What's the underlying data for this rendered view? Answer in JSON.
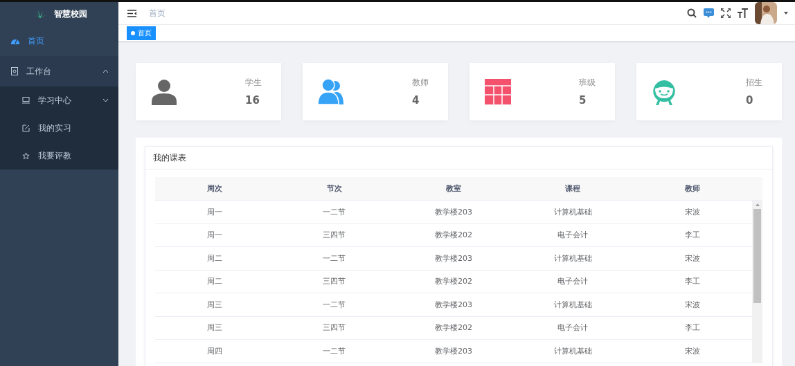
{
  "sidebar": {
    "logo": "智慧校园",
    "items": [
      {
        "label": "首页",
        "kind": "home",
        "selected": true
      },
      {
        "label": "工作台",
        "kind": "workbench",
        "selected": false,
        "expanded": true,
        "children": [
          {
            "label": "学习中心",
            "kind": "study",
            "selected": false,
            "expanded": false
          },
          {
            "label": "我的实习",
            "kind": "edit",
            "selected": false
          },
          {
            "label": "我要评教",
            "kind": "star",
            "selected": false
          }
        ]
      }
    ]
  },
  "header": {
    "breadcrumb": "首页"
  },
  "tags": [
    {
      "label": "首页",
      "selected": true
    }
  ],
  "stats": [
    {
      "label": "学生",
      "value": "16",
      "kind": "person",
      "color": "#666666"
    },
    {
      "label": "教师",
      "value": "4",
      "kind": "people",
      "color": "#36a3f7"
    },
    {
      "label": "班级",
      "value": "5",
      "kind": "table",
      "color": "#f4516c"
    },
    {
      "label": "招生",
      "value": "0",
      "kind": "smile",
      "color": "#34bfa3"
    }
  ],
  "schedule": {
    "title": "我的课表",
    "columns": [
      "周次",
      "节次",
      "教室",
      "课程",
      "教师"
    ],
    "rows": [
      [
        "周一",
        "一二节",
        "教学楼203",
        "计算机基础",
        "宋波"
      ],
      [
        "周一",
        "三四节",
        "教学楼202",
        "电子会计",
        "李工"
      ],
      [
        "周二",
        "一二节",
        "教学楼203",
        "计算机基础",
        "宋波"
      ],
      [
        "周二",
        "三四节",
        "教学楼202",
        "电子会计",
        "李工"
      ],
      [
        "周三",
        "一二节",
        "教学楼203",
        "计算机基础",
        "宋波"
      ],
      [
        "周三",
        "三四节",
        "教学楼202",
        "电子会计",
        "李工"
      ],
      [
        "周四",
        "一二节",
        "教学楼203",
        "计算机基础",
        "宋波"
      ]
    ]
  }
}
